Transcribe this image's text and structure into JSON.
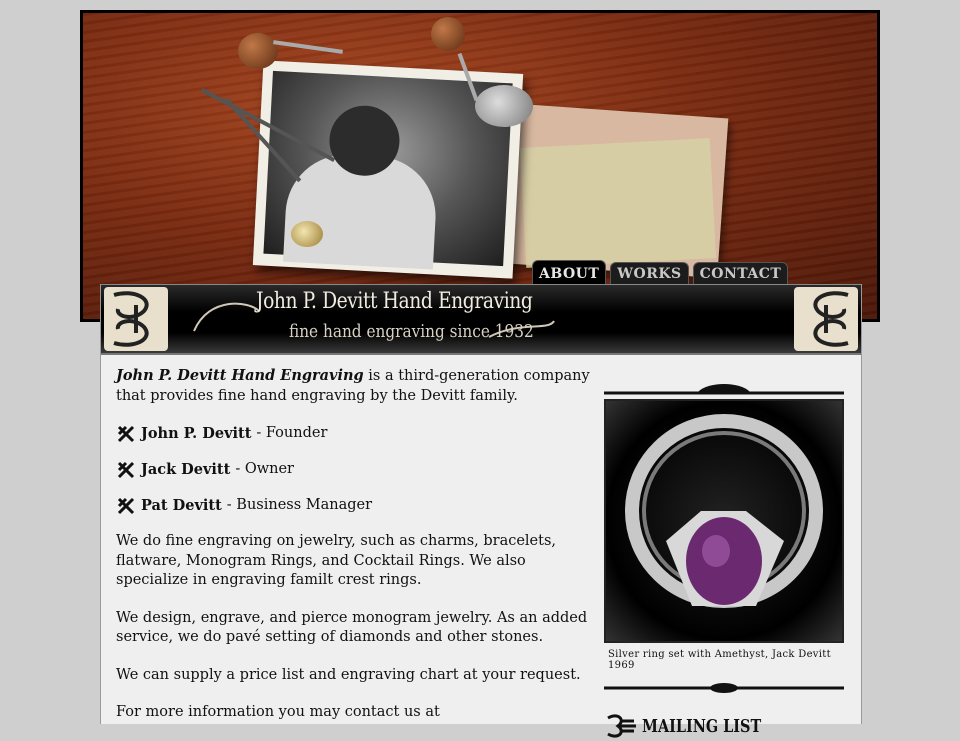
{
  "nav": {
    "tabs": [
      {
        "label": "ABOUT",
        "active": true
      },
      {
        "label": "WORKS",
        "active": false
      },
      {
        "label": "CONTACT",
        "active": false
      }
    ]
  },
  "banner": {
    "title": "John P. Devitt Hand Engraving",
    "tagline": "fine hand engraving since 1932"
  },
  "content": {
    "intro_name": "John P. Devitt Hand Engraving",
    "intro_rest": " is a third-generation company that provides fine hand engraving by the Devitt family.",
    "people": [
      {
        "name": "John P. Devitt",
        "role": "- Founder"
      },
      {
        "name": "Jack Devitt",
        "role": "- Owner"
      },
      {
        "name": "Pat Devitt",
        "role": "- Business Manager"
      }
    ],
    "paragraphs": [
      "We do fine engraving on jewelry, such as charms, bracelets, flatware, Monogram Rings, and Cocktail Rings. We also specialize in engraving familt crest rings.",
      "We design, engrave, and pierce monogram jewelry. As an added service, we do pavé setting of diamonds and other stones.",
      "We can supply a price list and engraving chart at your request.",
      "For more information you may contact us at"
    ]
  },
  "sidebar": {
    "ring_caption": "Silver ring set with Amethyst, Jack Devitt 1969",
    "mailing_label": "MAILING LIST"
  },
  "colors": {
    "page_bg": "#efefef",
    "banner_bg": "#000000",
    "wood": "#7a2a10"
  }
}
